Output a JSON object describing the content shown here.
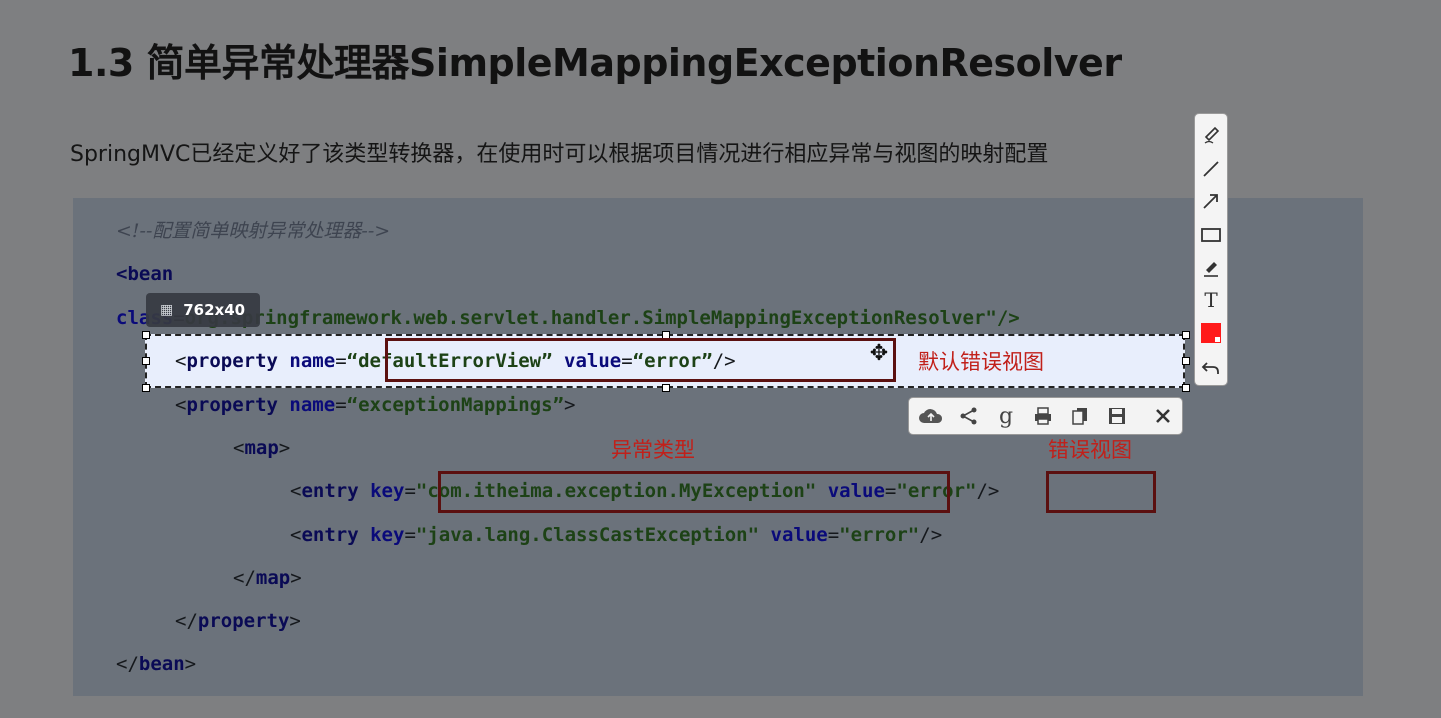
{
  "slide": {
    "title": "1.3 简单异常处理器SimpleMappingExceptionResolver",
    "description": "SpringMVC已经定义好了该类型转换器，在使用时可以根据项目情况进行相应异常与视图的映射配置"
  },
  "code": {
    "comment": "<!--配置简单映射异常处理器-->",
    "bean_open": "<bean",
    "class_attr": "class",
    "class_eq": "=",
    "class_value": "org.springframework.web.servlet.handler.SimpleMappingExceptionResolver\"/>",
    "prop1_lt": "<",
    "prop1_tag": "property",
    "prop1_name_attr": "name",
    "prop1_eq": "=",
    "prop1_name_val": "“defaultErrorView”",
    "prop1_value_attr": "value",
    "prop1_value_eq": "=",
    "prop1_value_val": "“error”",
    "prop1_close": "/>",
    "prop2_lt": "<",
    "prop2_tag": "property",
    "prop2_name_attr": "name",
    "prop2_eq": "=",
    "prop2_name_val": "“exceptionMappings”",
    "prop2_close": ">",
    "map_lt": "<",
    "map_tag": "map",
    "map_gt": ">",
    "entry1_lt": "<",
    "entry1_tag": "entry",
    "entry1_key_attr": "key",
    "entry1_eq": "=",
    "entry1_key_val": "\"com.itheima.exception.MyException\"",
    "entry1_value_attr": "value",
    "entry1_value_eq": "=",
    "entry1_value_val": "\"error\"",
    "entry1_close": "/>",
    "entry2_lt": "<",
    "entry2_tag": "entry",
    "entry2_key_attr": "key",
    "entry2_eq": "=",
    "entry2_key_val": "\"java.lang.ClassCastException\"",
    "entry2_value_attr": "value",
    "entry2_value_eq": "=",
    "entry2_value_val": "\"error\"",
    "entry2_close": "/>",
    "map_close_lt": "</",
    "map_close_tag": "map",
    "map_close_gt": ">",
    "prop_close_lt": "</",
    "prop_close_tag": "property",
    "prop_close_gt": ">",
    "bean_close_lt": "</",
    "bean_close_tag": "bean",
    "bean_close_gt": ">"
  },
  "annotations": {
    "default_error_view": "默认错误视图",
    "exception_type": "异常类型",
    "error_view": "错误视图"
  },
  "capture": {
    "size_label": "762x40"
  },
  "colors": {
    "annotation_red": "#c1201a",
    "box_border": "#5b1010",
    "selected_color": "#ff1a1a",
    "selection_fill": "#e8eefc"
  },
  "toolbar_vertical": {
    "items": [
      "pen-icon",
      "line-icon",
      "arrow-icon",
      "rectangle-icon",
      "marker-icon",
      "text-icon",
      "color-swatch",
      "undo-icon"
    ]
  },
  "toolbar_horizontal": {
    "items": [
      "cloud-upload-icon",
      "share-icon",
      "google-icon",
      "print-icon",
      "copy-icon",
      "save-icon",
      "close-icon"
    ]
  }
}
